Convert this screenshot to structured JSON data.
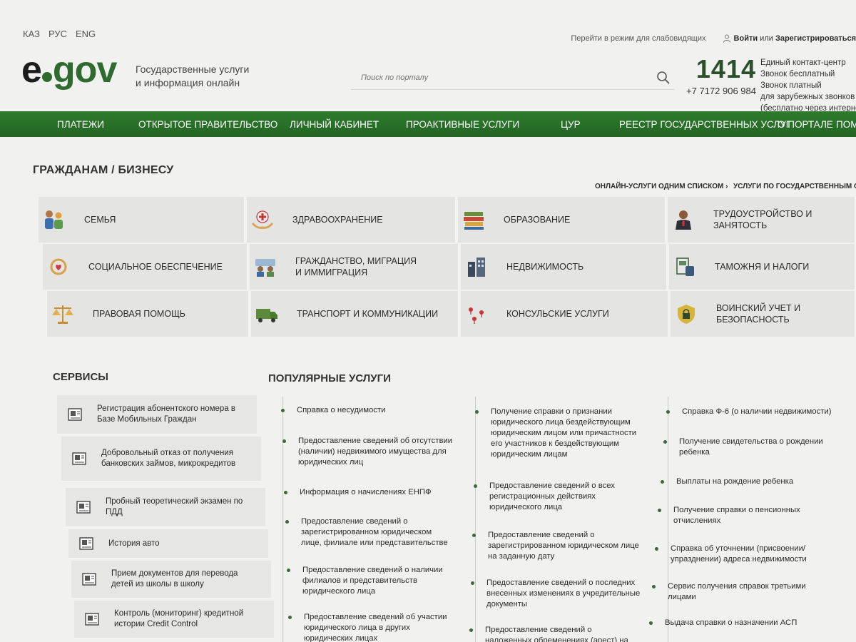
{
  "languages": [
    "КАЗ",
    "РУС",
    "ENG"
  ],
  "header": {
    "accessibility_link": "Перейти в режим для слабовидящих",
    "login_link": "Войти",
    "login_or": "или",
    "register_link": "Зарегистрироваться",
    "logo_e": "e",
    "logo_gov": "gov",
    "tagline_line1": "Государственные услуги",
    "tagline_line2": "и информация онлайн",
    "search_placeholder": "Поиск по порталу",
    "hotline_number": "1414",
    "hotline_phone": "+7 7172 906 984",
    "hotline_info": [
      "Единый контакт-центр",
      "Звонок бесплатный",
      "Звонок платный",
      "для зарубежных звонков",
      "(бесплатно через интернет)"
    ]
  },
  "nav": [
    "ПЛАТЕЖИ",
    "ОТКРЫТОЕ ПРАВИТЕЛЬСТВО",
    "ЛИЧНЫЙ КАБИНЕТ",
    "ПРОАКТИВНЫЕ УСЛУГИ",
    "ЦУР",
    "РЕЕСТР ГОСУДАРСТВЕННЫХ УСЛУГ",
    "О ПОРТАЛЕ",
    "ПОМОЩЬ"
  ],
  "categories_title": "ГРАЖДАНАМ / БИЗНЕСУ",
  "quick_links": [
    "ОНЛАЙН-УСЛУГИ ОДНИМ СПИСКОМ ›",
    "УСЛУГИ ПО ГОСУДАРСТВЕННЫМ ОРГАНАМ"
  ],
  "categories": [
    [
      "СЕМЬЯ",
      "ЗДРАВООХРАНЕНИЕ",
      "ОБРАЗОВАНИЕ",
      "ТРУДОУСТРОЙСТВО И ЗАНЯТОСТЬ"
    ],
    [
      "СОЦИАЛЬНОЕ ОБЕСПЕЧЕНИЕ",
      "ГРАЖДАНСТВО, МИГРАЦИЯ И ИММИГРАЦИЯ",
      "НЕДВИЖИМОСТЬ",
      "ТАМОЖНЯ И НАЛОГИ"
    ],
    [
      "ПРАВОВАЯ ПОМОЩЬ",
      "ТРАНСПОРТ И КОММУНИКАЦИИ",
      "КОНСУЛЬСКИЕ УСЛУГИ",
      "ВОИНСКИЙ УЧЕТ И БЕЗОПАСНОСТЬ"
    ]
  ],
  "services_title": "СЕРВИСЫ",
  "services": [
    "Регистрация абонентского номера в Базе Мобильных Граждан",
    "Добровольный отказ от получения банковских займов, микрокредитов",
    "Пробный теоретический экзамен по ПДД",
    "История авто",
    "Прием документов для перевода детей из школы в школу",
    "Контроль (мониторинг) кредитной истории Credit Control"
  ],
  "popular_title": "ПОПУЛЯРНЫЕ УСЛУГИ",
  "popular": [
    [
      "Справка о несудимости",
      "Предоставление сведений об отсутствии (наличии) недвижимого имущества для юридических лиц",
      "Информация о начислениях ЕНПФ",
      "Предоставление сведений о зарегистрированном юридическом лице, филиале или представительстве",
      "Предоставление сведений о наличии филиалов и представительств юридического лица",
      "Предоставление сведений об участии юридического лица в других юридических лицах"
    ],
    [
      "Получение справки о признании юридического лица бездействующим юридическим лицом или причастности его участников к бездействующим юридическим лицам",
      "Предоставление сведений о всех регистрационных действиях юридического лица",
      "Предоставление сведений о зарегистрированном юридическом лице на заданную дату",
      "Предоставление сведений о последних внесенных изменениях в учредительные документы",
      "Предоставление сведений о наложенных обременениях (арест) на"
    ],
    [
      "Справка Ф-6 (о наличии недвижимости)",
      "Получение свидетельства о рождении ребенка",
      "Выплаты на рождение ребенка",
      "Получение справки о пенсионных отчислениях",
      "Справка об уточнении (присвоении/ упразднении) адреса недвижимости",
      "Сервис получения справок третьими лицами",
      "Выдача справки о назначении АСП"
    ]
  ]
}
